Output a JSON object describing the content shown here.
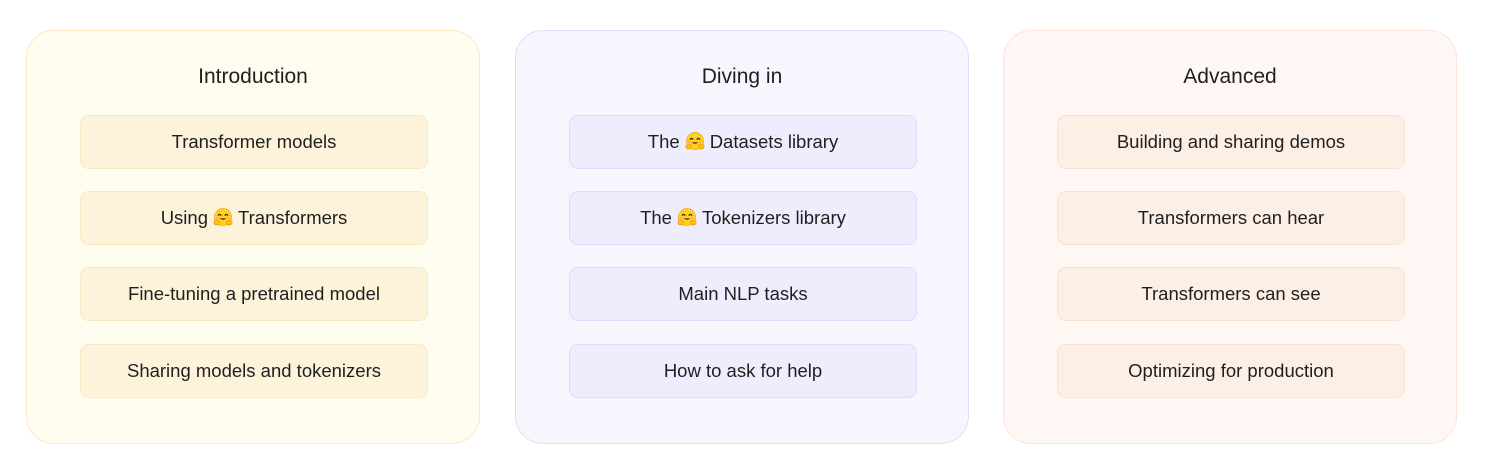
{
  "panels": {
    "introduction": {
      "title": "Introduction",
      "items": [
        {
          "label": "Transformer models"
        },
        {
          "before": "Using",
          "icon": "hugging-face-icon",
          "after": "Transformers"
        },
        {
          "label": "Fine-tuning a pretrained model"
        },
        {
          "label": "Sharing models and tokenizers"
        }
      ]
    },
    "diving_in": {
      "title": "Diving in",
      "items": [
        {
          "before": "The",
          "icon": "hugging-face-icon",
          "after": "Datasets library"
        },
        {
          "before": "The",
          "icon": "hugging-face-icon",
          "after": "Tokenizers library"
        },
        {
          "label": "Main NLP tasks"
        },
        {
          "label": "How to ask for help"
        }
      ]
    },
    "advanced": {
      "title": "Advanced",
      "items": [
        {
          "label": "Building and sharing demos"
        },
        {
          "label": "Transformers can hear"
        },
        {
          "label": "Transformers can see"
        },
        {
          "label": "Optimizing for production"
        }
      ]
    }
  },
  "colors": {
    "intro_bg": "#fffcf0",
    "intro_item": "#fdf3db",
    "diving_bg": "#f7f6ff",
    "diving_item": "#eeedfd",
    "advanced_bg": "#fff7f4",
    "advanced_item": "#fcefe5"
  }
}
